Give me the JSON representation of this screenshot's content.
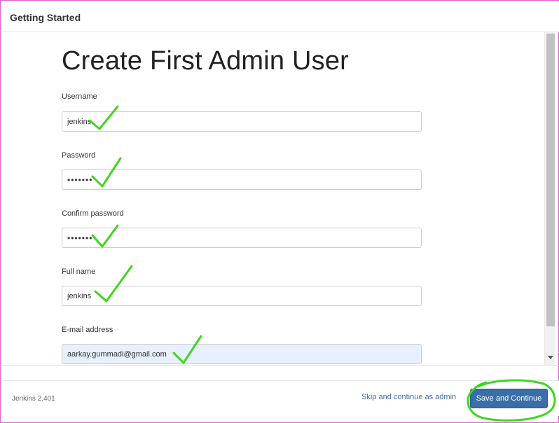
{
  "header": {
    "title": "Getting Started"
  },
  "form": {
    "title": "Create First Admin User",
    "fields": [
      {
        "label": "Username",
        "value": "jenkins"
      },
      {
        "label": "Password",
        "value": "•••••••"
      },
      {
        "label": "Confirm password",
        "value": "•••••••"
      },
      {
        "label": "Full name",
        "value": "jenkins"
      },
      {
        "label": "E-mail address",
        "value": "aarkay.gummadi@gmail.com"
      }
    ]
  },
  "footer": {
    "version": "Jenkins 2.401",
    "skip_label": "Skip and continue as admin",
    "save_label": "Save and Continue"
  },
  "colors": {
    "accent": "#3a6ea8",
    "link": "#3f6fa8",
    "annotation": "#3fd61e",
    "autofill": "#e8f0fe"
  }
}
